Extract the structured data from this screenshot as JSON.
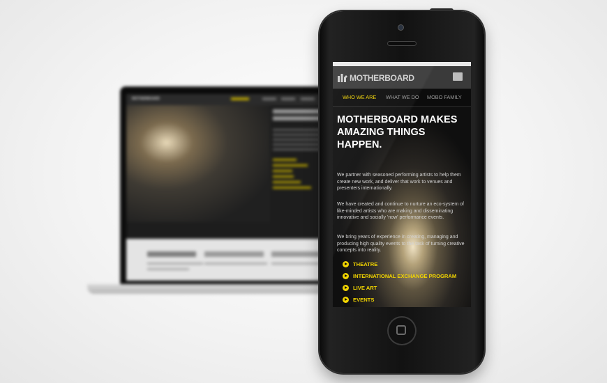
{
  "laptop": {
    "logo": "MOTHERBOARD"
  },
  "phone": {
    "logo_text": "MOTHERBOARD",
    "nav": [
      "WHO WE ARE",
      "WHAT WE DO",
      "MOBO FAMILY"
    ],
    "headline": "MOTHERBOARD MAKES AMAZING THINGS HAPPEN.",
    "paragraphs": [
      "We partner with seasoned performing artists to help them create new work, and deliver that work to venues and presenters internationally.",
      "We have created and continue to nurture an eco-system of like-minded artists who are making and disseminating innovative and socially 'now' performance events.",
      "We bring years of experience in creating, managing and producing high quality events to the task of turning creative concepts into reality."
    ],
    "links": [
      "THEATRE",
      "INTERNATIONAL EXCHANGE PROGRAM",
      "LIVE ART",
      "EVENTS"
    ],
    "accent": "#f2d500"
  }
}
